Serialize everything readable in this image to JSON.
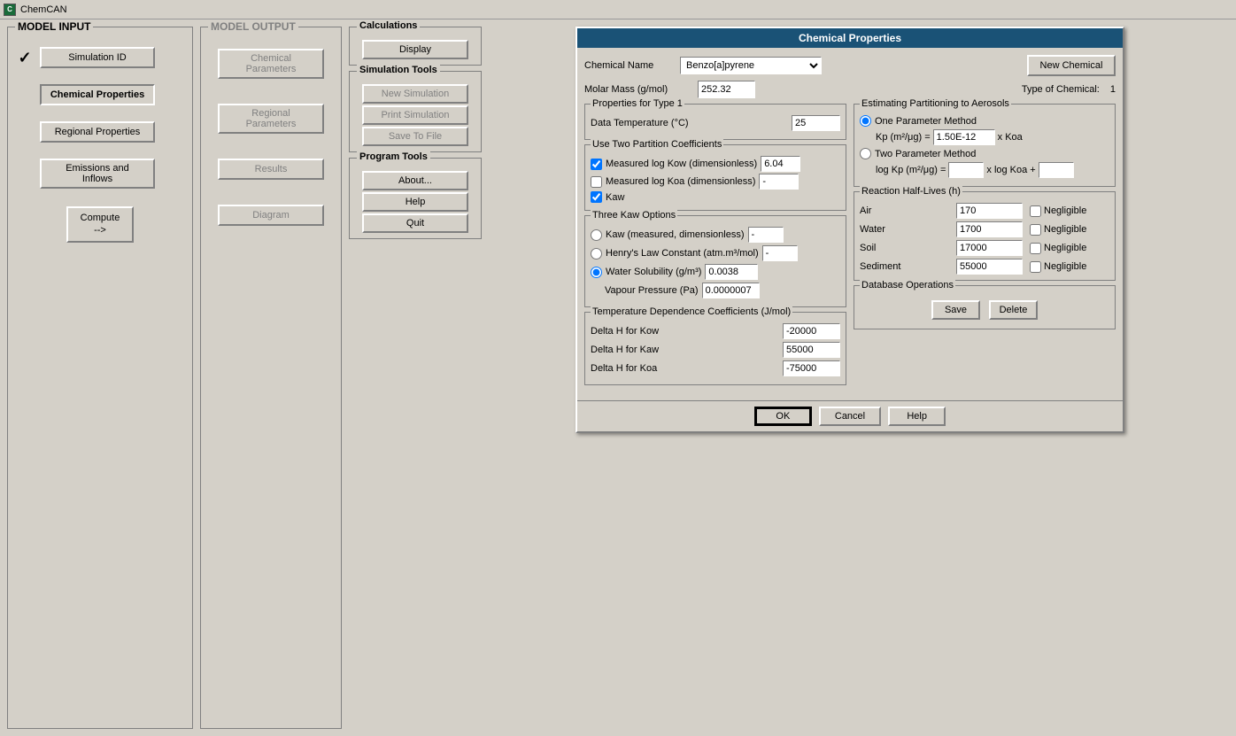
{
  "app": {
    "title": "ChemCAN",
    "icon_text": "C"
  },
  "model_input": {
    "section_title": "MODEL INPUT",
    "nav_items": [
      {
        "id": "simulation-id",
        "label": "Simulation ID",
        "has_check": true
      },
      {
        "id": "chemical-properties",
        "label": "Chemical Properties",
        "has_check": false,
        "active": true
      },
      {
        "id": "regional-properties",
        "label": "Regional Properties",
        "has_check": false
      },
      {
        "id": "emissions-inflows",
        "label": "Emissions and\nInflows",
        "has_check": false
      }
    ],
    "compute_label": "Compute\n-->"
  },
  "model_output": {
    "section_title": "MODEL OUTPUT",
    "buttons": [
      {
        "id": "chemical-parameters",
        "label": "Chemical Parameters"
      },
      {
        "id": "regional-parameters",
        "label": "Regional\nParameters"
      },
      {
        "id": "results",
        "label": "Results"
      },
      {
        "id": "diagram",
        "label": "Diagram"
      }
    ]
  },
  "calculations": {
    "title": "Calculations",
    "display_label": "Display"
  },
  "simulation_tools": {
    "title": "Simulation Tools",
    "buttons": [
      {
        "id": "new-simulation",
        "label": "New Simulation"
      },
      {
        "id": "print-simulation",
        "label": "Print Simulation"
      },
      {
        "id": "save-to-file",
        "label": "Save To File"
      }
    ]
  },
  "program_tools": {
    "title": "Program Tools",
    "buttons": [
      {
        "id": "about",
        "label": "About..."
      },
      {
        "id": "help",
        "label": "Help"
      },
      {
        "id": "quit",
        "label": "Quit"
      }
    ]
  },
  "chem_dialog": {
    "title": "Chemical Properties",
    "chemical_name_label": "Chemical Name",
    "chemical_name_value": "Benzo[a]pyrene",
    "new_chemical_label": "New Chemical",
    "molar_mass_label": "Molar Mass (g/mol)",
    "molar_mass_value": "252.32",
    "type_of_chemical_label": "Type of Chemical:",
    "type_of_chemical_value": "1",
    "properties_group": {
      "title": "Properties for Type 1",
      "data_temp_label": "Data Temperature (°C)",
      "data_temp_value": "25"
    },
    "partition_coefficients": {
      "title": "Use Two Partition Coefficients",
      "rows": [
        {
          "id": "meas-log-kow",
          "label": "Measured log Kow (dimensionless)",
          "checked": true,
          "value": "6.04"
        },
        {
          "id": "meas-log-koa",
          "label": "Measured log Koa (dimensionless)",
          "checked": false,
          "value": "-"
        },
        {
          "id": "kaw",
          "label": "Kaw",
          "checked": true,
          "value": ""
        }
      ]
    },
    "kaw_options": {
      "title": "Three Kaw Options",
      "rows": [
        {
          "id": "kaw-measured",
          "label": "Kaw (measured, dimensionless)",
          "value": "-"
        },
        {
          "id": "henrys-law",
          "label": "Henry's Law Constant (atm.m³/mol)",
          "value": "-"
        },
        {
          "id": "water-solubility",
          "label": "Water Solubility (g/m³)",
          "value": "0.0038",
          "selected": true
        },
        {
          "id": "vapour-pressure",
          "label": "Vapour Pressure (Pa)",
          "value": "0.0000007"
        }
      ]
    },
    "temp_dependence": {
      "title": "Temperature Dependence Coefficients (J/mol)",
      "rows": [
        {
          "id": "delta-h-kow",
          "label": "Delta H for Kow",
          "value": "-20000"
        },
        {
          "id": "delta-h-kaw",
          "label": "Delta H for Kaw",
          "value": "55000"
        },
        {
          "id": "delta-h-koa",
          "label": "Delta H for Koa",
          "value": "-75000"
        }
      ]
    },
    "estimating_partitioning": {
      "title": "Estimating Partitioning to Aerosols",
      "one_param": {
        "label": "One Parameter Method",
        "kp_label": "Kp (m²/μg) =",
        "kp_value": "1.50E-12",
        "x_koa": "x Koa",
        "selected": true
      },
      "two_param": {
        "label": "Two Parameter Method",
        "log_kp_label": "log Kp (m²/μg) =",
        "x_log_koa": "x log Koa +",
        "value1": "",
        "value2": "",
        "selected": false
      }
    },
    "reaction_halflives": {
      "title": "Reaction Half-Lives (h)",
      "rows": [
        {
          "id": "air",
          "label": "Air",
          "value": "170"
        },
        {
          "id": "water",
          "label": "Water",
          "value": "1700"
        },
        {
          "id": "soil",
          "label": "Soil",
          "value": "17000"
        },
        {
          "id": "sediment",
          "label": "Sediment",
          "value": "55000"
        }
      ],
      "negligible_label": "Negligible"
    },
    "database_operations": {
      "title": "Database Operations",
      "save_label": "Save",
      "delete_label": "Delete"
    },
    "footer": {
      "ok_label": "OK",
      "cancel_label": "Cancel",
      "help_label": "Help"
    }
  }
}
